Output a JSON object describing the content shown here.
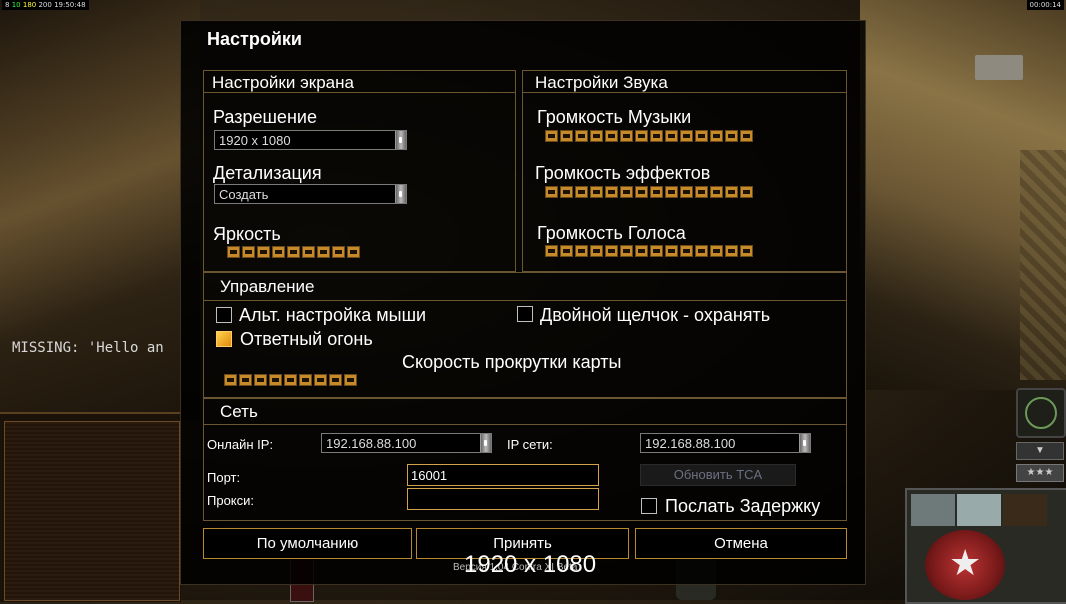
{
  "hud": {
    "top_left_prefix": "8",
    "top_left_green": "10",
    "top_left_yellow": "180",
    "top_left_mid": "200",
    "top_left_time": "19:50:48",
    "top_right_time": "00:00:14",
    "missing_text": "MISSING: 'Hello an"
  },
  "dialog": {
    "title": "Настройки",
    "screen": {
      "header": "Настройки экрана",
      "resolution_label": "Разрешение",
      "resolution_value": "1920 x 1080",
      "detail_label": "Детализация",
      "detail_value": "Создать",
      "brightness_label": "Яркость"
    },
    "sound": {
      "header": "Настройки Звука",
      "music_label": "Громкость Музыки",
      "effects_label": "Громкость эффектов",
      "voice_label": "Громкость Голоса"
    },
    "controls": {
      "header": "Управление",
      "alt_mouse_label": "Альт. настройка мыши",
      "alt_mouse_checked": false,
      "double_click_label": "Двойной щелчок - охранять",
      "double_click_checked": false,
      "return_fire_label": "Ответный огонь",
      "return_fire_checked": true,
      "scroll_speed_label": "Скорость прокрутки карты"
    },
    "network": {
      "header": "Сеть",
      "online_ip_label": "Онлайн IP:",
      "online_ip_value": "192.168.88.100",
      "lan_ip_label": "IP сети:",
      "lan_ip_value": "192.168.88.100",
      "port_label": "Порт:",
      "port_value": "16001",
      "proxy_label": "Прокси:",
      "proxy_value": "",
      "update_tca_label": "Обновить TCA",
      "send_delay_label": "Послать Задержку",
      "send_delay_checked": false
    },
    "buttons": {
      "defaults": "По умолчанию",
      "accept": "Принять",
      "cancel": "Отмена"
    }
  },
  "overlay": {
    "resolution_text": "1920 x 1080",
    "version_text": "Версия 1.04 Contra XI Beta"
  },
  "colors": {
    "slider_segment": "#c68a2a",
    "frame_border": "#6a5631",
    "button_border": "#b8892e",
    "checkbox_checked": "#f0a020"
  },
  "sliders": {
    "brightness_segments": 9,
    "music_segments": 14,
    "effects_segments": 14,
    "voice_segments": 14,
    "scroll_segments": 9
  }
}
